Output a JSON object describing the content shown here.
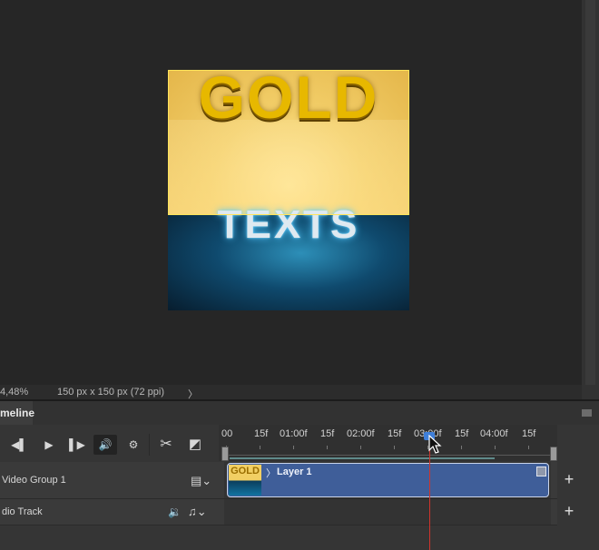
{
  "canvas": {
    "title_text": "GOLD",
    "lower_text": "TEXTS"
  },
  "status_bar": {
    "zoom": "4,48%",
    "doc_info": "150 px x 150 px (72 ppi)",
    "chevron": "〉"
  },
  "timeline": {
    "tab_label": "meline",
    "controls": {
      "prev_frame": "◀▌",
      "play": "▶",
      "next_frame": "▌▶",
      "audio": "🔊",
      "settings": "⚙",
      "split": "✂",
      "transition": "◩"
    },
    "ruler_labels": [
      "00",
      "15f",
      "01:00f",
      "15f",
      "02:00f",
      "15f",
      "03:00f",
      "15f",
      "04:00f",
      "15f"
    ],
    "playhead_time": "03:00f",
    "tracks": [
      {
        "label": "Video Group 1",
        "icon": "film-icon",
        "clip_label": "Layer 1",
        "thumb_text": "GOLD"
      },
      {
        "label": "dio Track",
        "icon": "music-icon"
      }
    ],
    "add_label": "+"
  },
  "colors": {
    "clip": "#3f5e99",
    "playhead": "#d0342c",
    "selection": "#ffe45a"
  }
}
